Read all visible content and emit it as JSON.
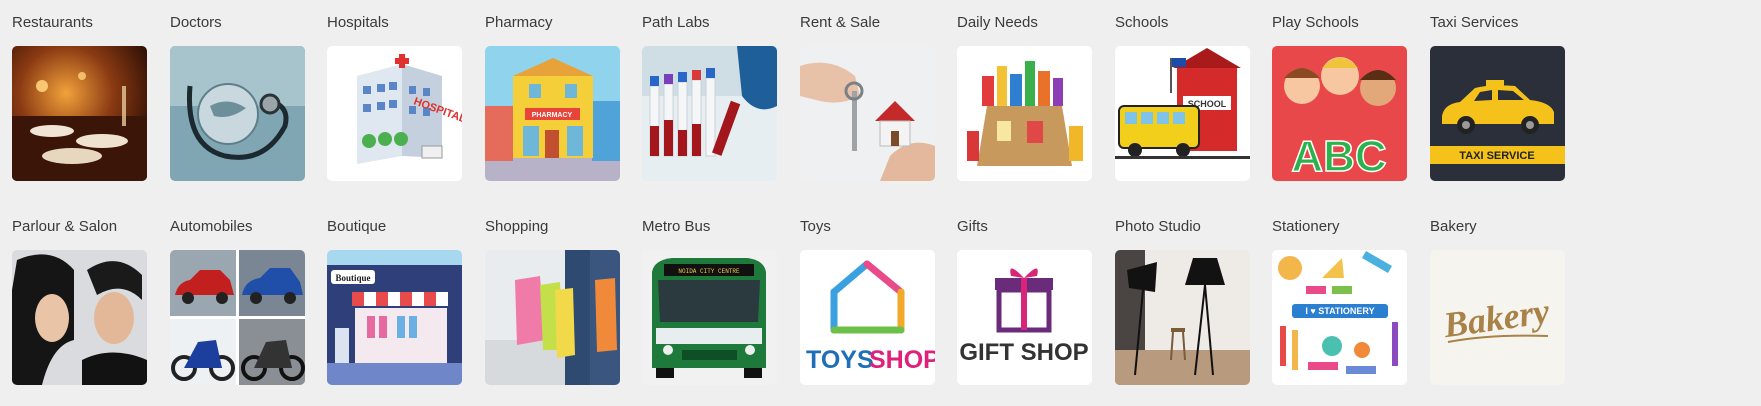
{
  "categories_row1": [
    {
      "label": "Restaurants",
      "icon": "restaurant-photo"
    },
    {
      "label": "Doctors",
      "icon": "stethoscope-globe-photo"
    },
    {
      "label": "Hospitals",
      "icon": "hospital-building-illustration"
    },
    {
      "label": "Pharmacy",
      "icon": "pharmacy-shop-illustration"
    },
    {
      "label": "Path Labs",
      "icon": "test-tubes-photo"
    },
    {
      "label": "Rent & Sale",
      "icon": "house-key-photo"
    },
    {
      "label": "Daily Needs",
      "icon": "groceries-photo"
    },
    {
      "label": "Schools",
      "icon": "school-bus-illustration"
    },
    {
      "label": "Play Schools",
      "icon": "kids-abc-illustration"
    },
    {
      "label": "Taxi Services",
      "icon": "taxi-car-illustration"
    }
  ],
  "categories_row2": [
    {
      "label": "Parlour & Salon",
      "icon": "salon-models-photo"
    },
    {
      "label": "Automobiles",
      "icon": "cars-bikes-collage"
    },
    {
      "label": "Boutique",
      "icon": "boutique-shop-illustration"
    },
    {
      "label": "Shopping",
      "icon": "shopping-bags-photo"
    },
    {
      "label": "Metro Bus",
      "icon": "green-bus-photo"
    },
    {
      "label": "Toys",
      "icon": "toys-shop-logo"
    },
    {
      "label": "Gifts",
      "icon": "gift-shop-logo"
    },
    {
      "label": "Photo Studio",
      "icon": "photo-studio-lights"
    },
    {
      "label": "Stationery",
      "icon": "stationery-items-illustration"
    },
    {
      "label": "Bakery",
      "icon": "bakery-script-logo"
    }
  ],
  "image_text": {
    "hospital_sign": "HOSPITAL",
    "pharmacy_sign": "PHARMACY",
    "school_sign": "SCHOOL",
    "abc": "ABC",
    "taxi_sign": "TAXI SERVICE",
    "boutique_sign": "Boutique",
    "bus_sign": "NOIDA CITY CENTRE",
    "toys_word1": "TOYS",
    "toys_word2": "SHOP",
    "gift_shop": "GIFT SHOP",
    "stationery_banner": "I ♥ STATIONERY",
    "bakery": "Bakery"
  },
  "colors": {
    "page_background": "#efefef",
    "label_text": "#3a3a3a"
  }
}
